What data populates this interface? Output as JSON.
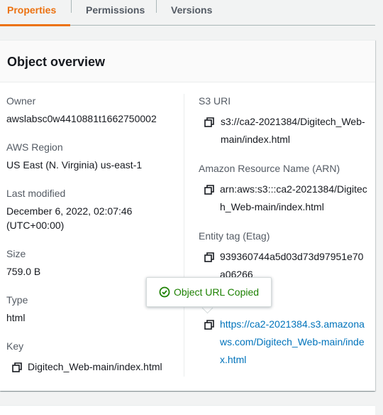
{
  "tabs": [
    {
      "label": "Properties",
      "active": true
    },
    {
      "label": "Permissions",
      "active": false
    },
    {
      "label": "Versions",
      "active": false
    }
  ],
  "panel": {
    "title": "Object overview",
    "left": {
      "owner_label": "Owner",
      "owner_value": "awslabsc0w4410881t1662750002",
      "region_label": "AWS Region",
      "region_value": "US East (N. Virginia) us-east-1",
      "modified_label": "Last modified",
      "modified_value_1": "December 6, 2022, 02:07:46",
      "modified_value_2": "(UTC+00:00)",
      "size_label": "Size",
      "size_value": "759.0 B",
      "type_label": "Type",
      "type_value": "html",
      "key_label": "Key",
      "key_value": "Digitech_Web-main/index.html"
    },
    "right": {
      "s3uri_label": "S3 URI",
      "s3uri_value": "s3://ca2-2021384/Digitech_Web-main/index.html",
      "arn_label": "Amazon Resource Name (ARN)",
      "arn_value": "arn:aws:s3:::ca2-2021384/Digitech_Web-main/index.html",
      "etag_label": "Entity tag (Etag)",
      "etag_value": "939360744a5d03d73d97951e70a06266",
      "url_value": "https://ca2-2021384.s3.amazonaws.com/Digitech_Web-main/index.html"
    }
  },
  "popover": {
    "message": "Object URL Copied"
  },
  "colors": {
    "accent": "#ec7211",
    "link": "#0073bb",
    "success": "#1d8102"
  },
  "icons": {
    "copy": "copy-icon",
    "success": "check-circle-icon"
  }
}
